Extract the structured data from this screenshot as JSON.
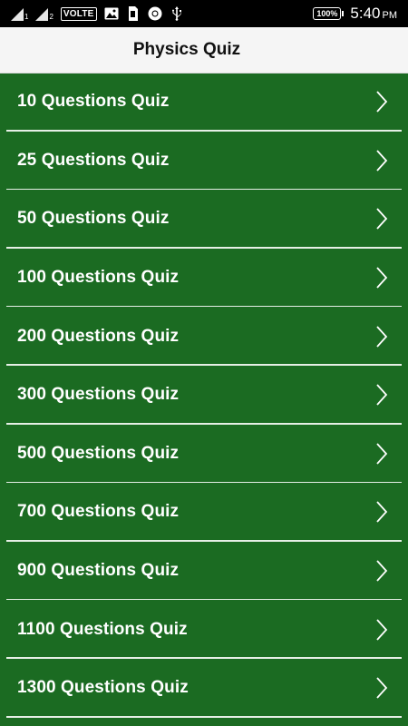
{
  "status_bar": {
    "sim1": "1",
    "sim2": "2",
    "volte": "VOLTE",
    "battery": "100%",
    "time": "5:40",
    "ampm": "PM",
    "icons": [
      "signal-icon",
      "signal-icon",
      "image-icon",
      "sim-card-icon",
      "chrome-icon",
      "usb-icon"
    ]
  },
  "app_bar": {
    "title": "Physics Quiz"
  },
  "quizzes": [
    "10 Questions Quiz",
    "25 Questions Quiz",
    "50 Questions Quiz",
    "100 Questions Quiz",
    "200 Questions Quiz",
    "300 Questions Quiz",
    "500 Questions Quiz",
    "700 Questions Quiz",
    "900 Questions Quiz",
    "1100 Questions Quiz",
    "1300 Questions Quiz"
  ],
  "colors": {
    "background": "#1b6b22",
    "app_bar": "#f5f5f5",
    "status_bar": "#000000",
    "divider": "#e6efe6"
  }
}
